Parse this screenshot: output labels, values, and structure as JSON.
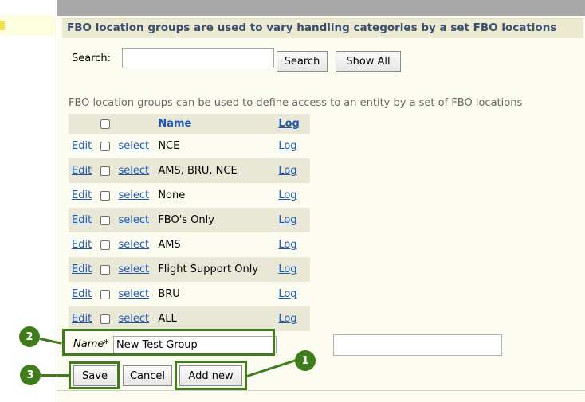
{
  "sidebar": {
    "selected_indicator": "s"
  },
  "header": {
    "title": "FBO location groups are used to vary handling categories by a set FBO locations"
  },
  "search": {
    "label": "Search:",
    "value": "",
    "placeholder": "",
    "search_button": "Search",
    "show_all_button": "Show All"
  },
  "info": "FBO location groups can be used to define access to an entity by a set of FBO locations",
  "table": {
    "headers": {
      "name": "Name",
      "log": "Log"
    },
    "row_actions": {
      "edit": "Edit",
      "select": "select",
      "log": "Log"
    },
    "rows": [
      {
        "name": "NCE"
      },
      {
        "name": "AMS, BRU, NCE"
      },
      {
        "name": "None"
      },
      {
        "name": "FBO's Only"
      },
      {
        "name": "AMS"
      },
      {
        "name": "Flight Support Only"
      },
      {
        "name": "BRU"
      },
      {
        "name": "ALL"
      }
    ]
  },
  "form": {
    "name_label": "Name*",
    "name_value": "New Test Group"
  },
  "actions": {
    "save": "Save",
    "cancel": "Cancel",
    "add_new": "Add new"
  },
  "annotations": {
    "badge_1": "1",
    "badge_2": "2",
    "badge_3": "3"
  },
  "colors": {
    "annotation_green": "#3e7c1c",
    "header_text": "#3a4f72",
    "link_blue": "#1d57b8",
    "alt_row": "#e9e8d6"
  }
}
